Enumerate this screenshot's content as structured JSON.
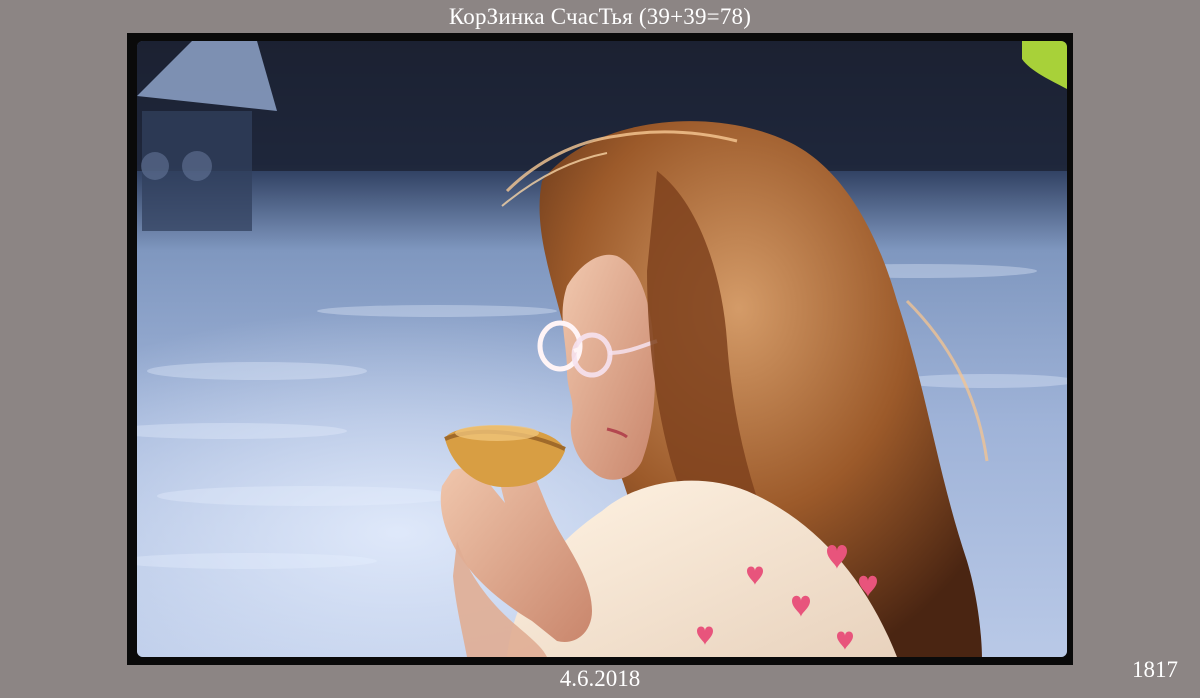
{
  "title": "КорЗинка СчасТья (39+39=78)",
  "date": "4.6.2018",
  "frame_number": "1817"
}
